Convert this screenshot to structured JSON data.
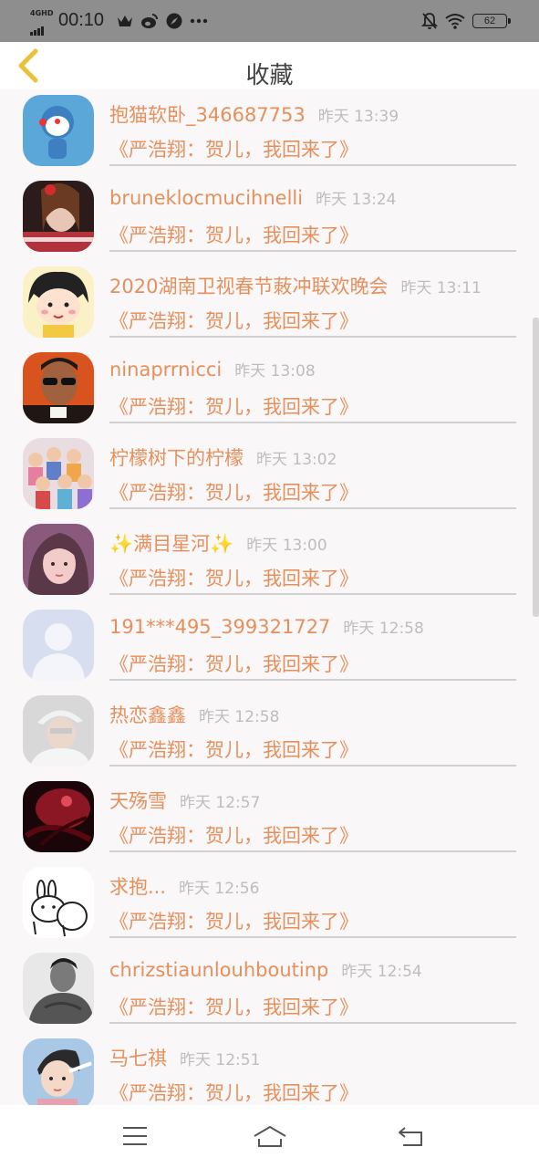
{
  "status_bar": {
    "network": "4GHD",
    "time": "00:10",
    "battery": "62",
    "icons": [
      "signal-icon",
      "crown-icon",
      "weibo-icon",
      "compass-icon",
      "more-dots-icon",
      "mute-bell-icon",
      "wifi-icon",
      "battery-icon"
    ]
  },
  "header": {
    "title": "收藏",
    "back_icon": "chevron-left-icon"
  },
  "message_text": "《严浩翔：贺儿，我回来了》",
  "items": [
    {
      "name": "抱猫软卧_346687753",
      "time": "昨天 13:39",
      "message": "《严浩翔：贺儿，我回来了》",
      "avatar_color": "#5aa7d8"
    },
    {
      "name": "bruneklocmucihnelli",
      "time": "昨天 13:24",
      "message": "《严浩翔：贺儿，我回来了》",
      "avatar_color": "#b2333b"
    },
    {
      "name": "2020湖南卫视春节蓛冲联欢晚会",
      "time": "昨天 13:11",
      "message": "《严浩翔：贺儿，我回来了》",
      "avatar_color": "#f3c944"
    },
    {
      "name": "ninaprrnicci",
      "time": "昨天 13:08",
      "message": "《严浩翔：贺儿，我回来了》",
      "avatar_color": "#8a3a1a"
    },
    {
      "name": "柠檬树下的柠檬",
      "time": "昨天 13:02",
      "message": "《严浩翔：贺儿，我回来了》",
      "avatar_color": "#5f7fc9"
    },
    {
      "name": "✨满目星河✨",
      "time": "昨天 13:00",
      "message": "《严浩翔：贺儿，我回来了》",
      "avatar_color": "#8a5a7c"
    },
    {
      "name": "191***495_399321727",
      "time": "昨天 12:58",
      "message": "《严浩翔：贺儿，我回来了》",
      "avatar_color": "#d7deef"
    },
    {
      "name": "热恋鑫鑫",
      "time": "昨天 12:58",
      "message": "《严浩翔：贺儿，我回来了》",
      "avatar_color": "#b9b9b9"
    },
    {
      "name": "天殇雪",
      "time": "昨天 12:57",
      "message": "《严浩翔：贺儿，我回来了》",
      "avatar_color": "#6a0f1a"
    },
    {
      "name": "求抱...",
      "time": "昨天 12:56",
      "message": "《严浩翔：贺儿，我回来了》",
      "avatar_color": "#ffffff"
    },
    {
      "name": "chrizstiaunlouhboutinp",
      "time": "昨天 12:54",
      "message": "《严浩翔：贺儿，我回来了》",
      "avatar_color": "#555555"
    },
    {
      "name": "马七祺",
      "time": "昨天 12:51",
      "message": "《严浩翔：贺儿，我回来了》",
      "avatar_color": "#a9c8e6"
    }
  ],
  "bottom_bar": {
    "icons": [
      "menu-icon",
      "home-icon",
      "back-icon"
    ]
  }
}
